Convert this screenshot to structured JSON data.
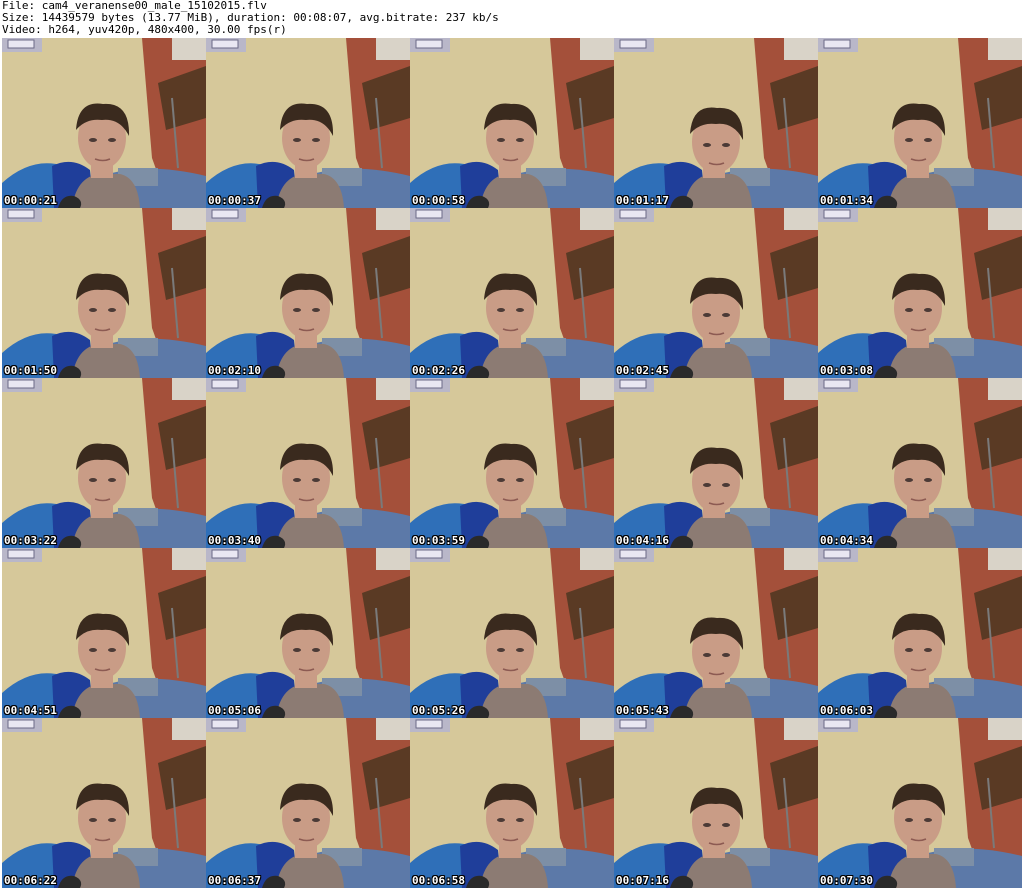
{
  "header": {
    "line1": "File: cam4_veranense00_male_15102015.flv",
    "line2": "Size: 14439579 bytes (13.77 MiB), duration: 00:08:07, avg.bitrate: 237 kb/s",
    "line3": "Video: h264, yuv420p, 480x400, 30.00 fps(r)"
  },
  "thumbnails": [
    {
      "timestamp": "00:00:21"
    },
    {
      "timestamp": "00:00:37"
    },
    {
      "timestamp": "00:00:58"
    },
    {
      "timestamp": "00:01:17"
    },
    {
      "timestamp": "00:01:34"
    },
    {
      "timestamp": "00:01:50"
    },
    {
      "timestamp": "00:02:10"
    },
    {
      "timestamp": "00:02:26"
    },
    {
      "timestamp": "00:02:45"
    },
    {
      "timestamp": "00:03:08"
    },
    {
      "timestamp": "00:03:22"
    },
    {
      "timestamp": "00:03:40"
    },
    {
      "timestamp": "00:03:59"
    },
    {
      "timestamp": "00:04:16"
    },
    {
      "timestamp": "00:04:34"
    },
    {
      "timestamp": "00:04:51"
    },
    {
      "timestamp": "00:05:06"
    },
    {
      "timestamp": "00:05:26"
    },
    {
      "timestamp": "00:05:43"
    },
    {
      "timestamp": "00:06:03"
    },
    {
      "timestamp": "00:06:22"
    },
    {
      "timestamp": "00:06:37"
    },
    {
      "timestamp": "00:06:58"
    },
    {
      "timestamp": "00:07:16"
    },
    {
      "timestamp": "00:07:30"
    }
  ],
  "colors": {
    "wall": "#d6c89a",
    "door": "#a4503a",
    "shelf": "#5a3a24",
    "blanket": "#2f6fb8",
    "skin": "#c99c86",
    "hair": "#3a2a1e"
  }
}
